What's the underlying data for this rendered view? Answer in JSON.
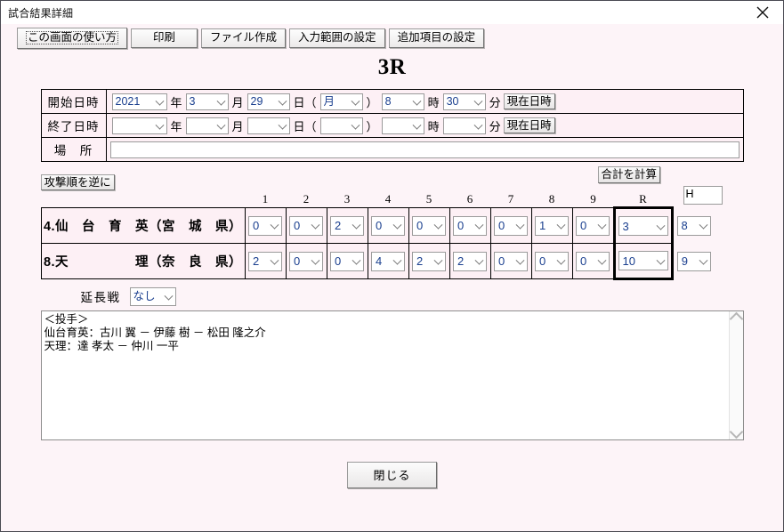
{
  "window": {
    "title": "試合結果詳細",
    "close_icon": "close-icon"
  },
  "toolbar": {
    "help_label": "この画面の使い方",
    "print_label": "印刷",
    "file_create_label": "ファイル作成",
    "input_range_label": "入力範囲の設定",
    "additional_items_label": "追加項目の設定"
  },
  "heading": "3R",
  "info": {
    "start": {
      "label": "開始日時",
      "year": "2021",
      "year_unit": "年",
      "month": "3",
      "month_unit": "月",
      "day": "29",
      "day_unit": "日（",
      "weekday": "月",
      "weekday_close": "）",
      "hour": "8",
      "hour_unit": "時",
      "minute": "30",
      "minute_unit": "分",
      "now_button": "現在日時"
    },
    "end": {
      "label": "終了日時",
      "year": "",
      "year_unit": "年",
      "month": "",
      "month_unit": "月",
      "day": "",
      "day_unit": "日（",
      "weekday": "",
      "weekday_close": "）",
      "hour": "",
      "hour_unit": "時",
      "minute": "",
      "minute_unit": "分",
      "now_button": "現在日時"
    },
    "place": {
      "label": "場　所",
      "value": ""
    }
  },
  "score": {
    "reverse_button": "攻撃順を逆に",
    "calc_button": "合計を計算",
    "h_header": "H",
    "h_box_value": "H",
    "columns": [
      "1",
      "2",
      "3",
      "4",
      "5",
      "6",
      "7",
      "8",
      "9",
      "R"
    ],
    "rows": [
      {
        "seed": "4.",
        "team": "仙　台　育　英（宮　城　県）",
        "innings": [
          "0",
          "0",
          "2",
          "0",
          "0",
          "0",
          "0",
          "1",
          "0"
        ],
        "runs": "3",
        "hits": "8"
      },
      {
        "seed": "8.",
        "team": "天　　　　　理（奈　良　県）",
        "innings": [
          "2",
          "0",
          "0",
          "4",
          "2",
          "2",
          "0",
          "0",
          "0"
        ],
        "runs": "10",
        "hits": "9"
      }
    ]
  },
  "extension": {
    "label": "延長戦",
    "value": "なし"
  },
  "memo": {
    "text": "＜投手＞\n仙台育英：古川 翼 － 伊藤 樹 － 松田 隆之介\n天理：達 孝太 － 仲川 一平",
    "scroll_up_icon": "chevron-up-icon",
    "scroll_down_icon": "chevron-down-icon"
  },
  "footer": {
    "close_label": "閉じる"
  }
}
